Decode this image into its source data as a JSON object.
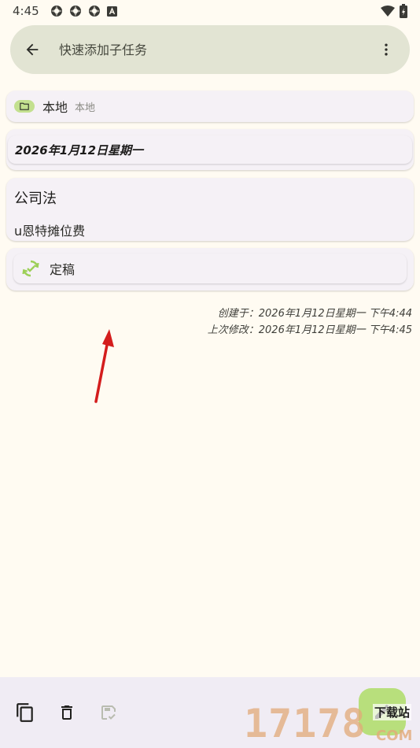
{
  "status": {
    "time": "4:45",
    "icons": [
      "app-icon",
      "app-icon",
      "app-icon",
      "notification-icon"
    ],
    "right_icons": [
      "wifi-icon",
      "battery-icon"
    ]
  },
  "header": {
    "placeholder": "快速添加子任务"
  },
  "folder": {
    "name": "本地",
    "sub": "本地"
  },
  "date": {
    "text": "2026年1月12日星期一"
  },
  "content": {
    "title": "公司法",
    "body": "u恩特摊位费"
  },
  "state": {
    "label": "定稿"
  },
  "meta": {
    "created": "创建于：2026年1月12日星期一 下午4:44",
    "modified": "上次修改：2026年1月12日星期一 下午4:45"
  },
  "watermark": {
    "number": "17178",
    "tag": "下载站",
    "com": "COM"
  },
  "colors": {
    "background": "#fffbf2",
    "top_bar": "#e2e4d3",
    "card": "#f5f1f6",
    "accent": "#b8df7c",
    "arrow": "#d41d1d"
  }
}
